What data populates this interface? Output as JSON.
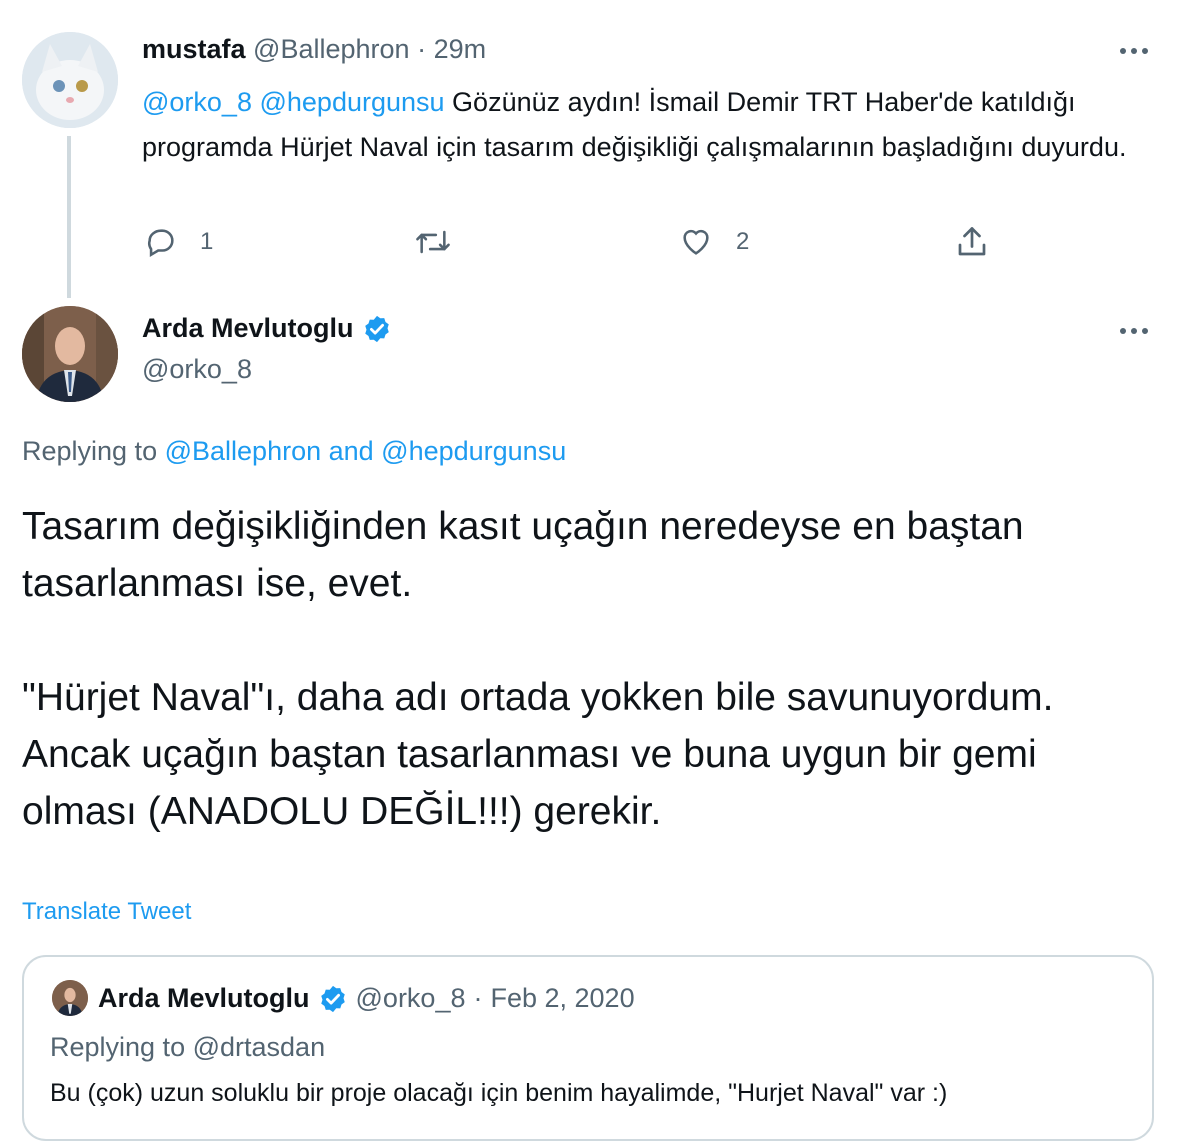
{
  "tweet1": {
    "display_name": "mustafa",
    "handle": "@Ballephron",
    "separator": "·",
    "time": "29m",
    "mentions": [
      "@orko_8",
      "@hepdurgunsu"
    ],
    "text": "Gözünüz aydın! İsmail Demir TRT Haber'de katıldığı programda Hürjet Naval için tasarım değişikliği çalışmalarının başladığını duyurdu.",
    "reply_count": "1",
    "retweet_count": "",
    "like_count": "2",
    "icons": {
      "reply": "reply-icon",
      "retweet": "retweet-icon",
      "like": "heart-icon",
      "share": "share-icon",
      "more": "more-icon"
    }
  },
  "tweet2": {
    "display_name": "Arda Mevlutoglu",
    "handle": "@orko_8",
    "verified": true,
    "replying_prefix": "Replying to",
    "replying_to": "@Ballephron and @hepdurgunsu",
    "text": "Tasarım değişikliğinden kasıt uçağın neredeyse en baştan tasarlanması ise, evet.\n\n\"Hürjet Naval\"ı, daha adı ortada yokken bile savunuyordum. Ancak uçağın baştan tasarlanması ve buna uygun bir gemi olması (ANADOLU DEĞİL!!!) gerekir.",
    "translate_label": "Translate Tweet"
  },
  "quote": {
    "display_name": "Arda Mevlutoglu",
    "handle": "@orko_8",
    "separator": "·",
    "date": "Feb 2, 2020",
    "replying_prefix": "Replying to",
    "replying_to": "@drtasdan",
    "text": "Bu (çok) uzun soluklu bir proje olacağı için benim hayalimde, \"Hurjet Naval\" var :)"
  },
  "colors": {
    "accent": "#1d9bf0",
    "text": "#0f1419",
    "secondary": "#536471",
    "border": "#cfd9de",
    "like_red": "#f91880"
  }
}
